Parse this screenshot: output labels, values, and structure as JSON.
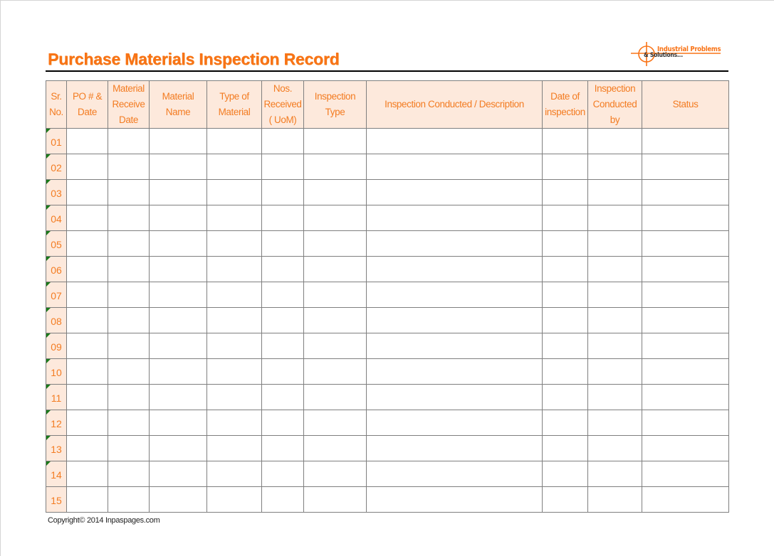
{
  "document": {
    "title": "Purchase Materials Inspection Record",
    "logo": {
      "line1": "Industrial Problems",
      "line2": "& Solutions...",
      "accent_color": "#f97316"
    },
    "copyright": "Copyright© 2014 Inpaspages.com"
  },
  "colors": {
    "accent": "#f37c22",
    "header_bg": "#fde9dc",
    "border": "#7f7f7f",
    "comment_marker": "#1a7a1a"
  },
  "table": {
    "columns": [
      {
        "key": "sr_no",
        "label": "Sr. No."
      },
      {
        "key": "po_date",
        "label": "PO # & Date"
      },
      {
        "key": "material_receive_date",
        "label": "Material Receive Date"
      },
      {
        "key": "material_name",
        "label": "Material Name"
      },
      {
        "key": "type_of_material",
        "label": "Type of Material"
      },
      {
        "key": "nos_received",
        "label": "Nos. Received ( UoM)"
      },
      {
        "key": "inspection_type",
        "label": "Inspection Type"
      },
      {
        "key": "inspection_description",
        "label": "Inspection Conducted / Description"
      },
      {
        "key": "date_of_inspection",
        "label": "Date of inspection"
      },
      {
        "key": "inspection_conducted_by",
        "label": "Inspection Conducted by"
      },
      {
        "key": "status",
        "label": "Status"
      }
    ],
    "header_lines": [
      [
        "Sr.",
        "No."
      ],
      [
        "PO # &",
        "Date"
      ],
      [
        "Material",
        "Receive",
        "Date"
      ],
      [
        "Material",
        "Name"
      ],
      [
        "Type of",
        "Material"
      ],
      [
        "Nos.",
        "Received",
        "( UoM)"
      ],
      [
        "Inspection",
        "Type"
      ],
      [
        "Inspection Conducted / Description"
      ],
      [
        "Date of",
        "inspection"
      ],
      [
        "Inspection",
        "Conducted",
        "by"
      ],
      [
        "Status"
      ]
    ],
    "rows": [
      {
        "sr": "01",
        "has_comment": true
      },
      {
        "sr": "02",
        "has_comment": true
      },
      {
        "sr": "03",
        "has_comment": true
      },
      {
        "sr": "04",
        "has_comment": true
      },
      {
        "sr": "05",
        "has_comment": true
      },
      {
        "sr": "06",
        "has_comment": true
      },
      {
        "sr": "07",
        "has_comment": true
      },
      {
        "sr": "08",
        "has_comment": true
      },
      {
        "sr": "09",
        "has_comment": true
      },
      {
        "sr": "10",
        "has_comment": true
      },
      {
        "sr": "11",
        "has_comment": true
      },
      {
        "sr": "12",
        "has_comment": true
      },
      {
        "sr": "13",
        "has_comment": true
      },
      {
        "sr": "14",
        "has_comment": true
      },
      {
        "sr": "15",
        "has_comment": false
      }
    ]
  }
}
